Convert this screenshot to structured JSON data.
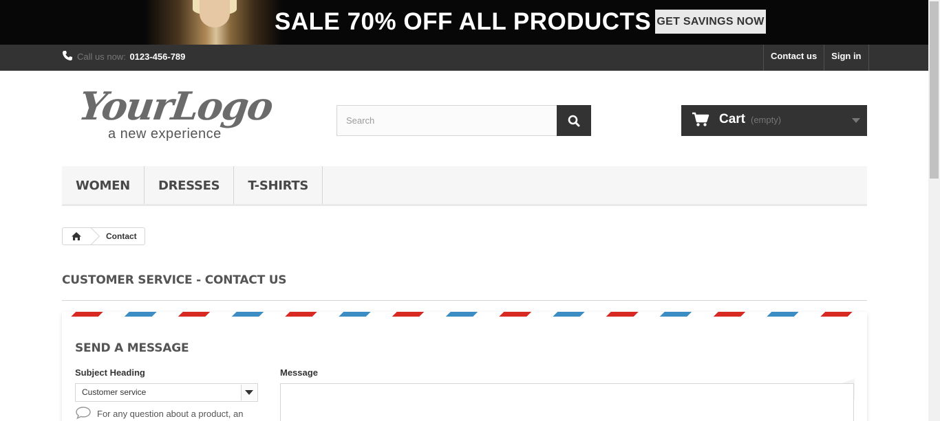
{
  "banner": {
    "headline": "SALE 70% OFF ALL PRODUCTS",
    "button_label": "GET SAVINGS NOW"
  },
  "topbar": {
    "call_label": "Call us now:",
    "phone": "0123-456-789",
    "links": [
      "Contact us",
      "Sign in"
    ]
  },
  "logo": {
    "main": "YourLogo",
    "tagline": "a new experience"
  },
  "search": {
    "placeholder": "Search"
  },
  "cart": {
    "label": "Cart",
    "status": "(empty)"
  },
  "menu": {
    "items": [
      "WOMEN",
      "DRESSES",
      "T-SHIRTS"
    ]
  },
  "breadcrumb": {
    "current": "Contact"
  },
  "page": {
    "heading": "CUSTOMER SERVICE - CONTACT US"
  },
  "contact_form": {
    "title": "SEND A MESSAGE",
    "subject_label": "Subject Heading",
    "subject_value": "Customer service",
    "hint": "For any question about a product, an",
    "message_label": "Message"
  },
  "colors": {
    "dark": "#333333",
    "stripe_red": "#d82922",
    "stripe_blue": "#3c8dc4"
  },
  "icons": [
    "phone-icon",
    "search-icon",
    "cart-icon",
    "chevron-down-icon",
    "home-icon",
    "speech-bubble-icon"
  ]
}
